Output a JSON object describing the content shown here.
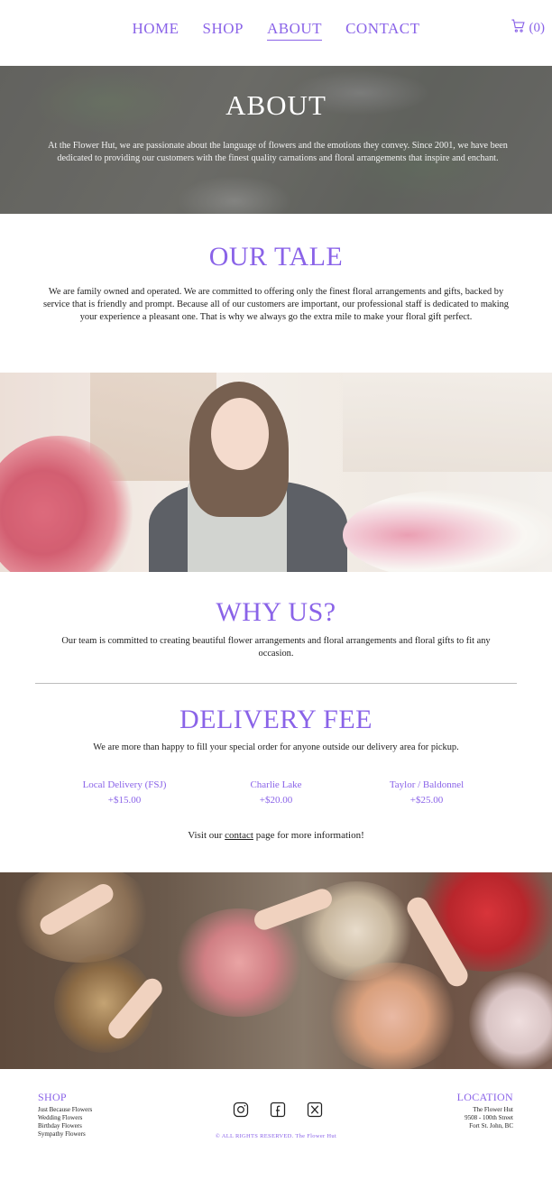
{
  "nav": {
    "links": [
      "HOME",
      "SHOP",
      "ABOUT",
      "CONTACT"
    ],
    "active": "ABOUT",
    "cart_count": "(0)",
    "cart_icon": "cart-icon"
  },
  "hero": {
    "title": "ABOUT",
    "text": "At the Flower Hut, we are passionate about the language of flowers and the emotions they convey. Since 2001, we have been dedicated to providing our customers with the finest quality carnations and floral arrangements that inspire and enchant."
  },
  "tale": {
    "title": "OUR TALE",
    "text": "We are family owned and operated. We are committed to offering only the finest floral arrangements and gifts, backed by service that is friendly and prompt. Because all of our customers are important, our professional staff is dedicated to making your experience a pleasant one. That is why we always go the extra mile to make your floral gift perfect."
  },
  "why": {
    "title": "WHY US?",
    "text": "Our team is committed to creating beautiful flower arrangements and floral arrangements and floral gifts to fit any occasion."
  },
  "delivery": {
    "title": "DELIVERY FEE",
    "text": "We are more than happy to fill your special order for anyone outside our delivery area for pickup.",
    "fees": [
      {
        "area": "Local Delivery (FSJ)",
        "price": "+$15.00"
      },
      {
        "area": "Charlie Lake",
        "price": "+$20.00"
      },
      {
        "area": "Taylor / Baldonnel",
        "price": "+$25.00"
      }
    ],
    "visit_before": "Visit our ",
    "visit_link": "contact",
    "visit_after": " page for more information!"
  },
  "footer": {
    "shop_title": "SHOP",
    "shop_items": [
      "Just Because Flowers",
      "Wedding Flowers",
      "Birthday Flowers",
      "Sympathy Flowers"
    ],
    "location_title": "LOCATION",
    "location_lines": [
      "The Flower Hut",
      "9508 - 100th Street",
      "Fort St. John, BC"
    ],
    "socials": [
      "instagram-icon",
      "facebook-icon",
      "x-icon"
    ],
    "copyright": "© ALL RIGHTS RESERVED. The Flower Hut"
  },
  "colors": {
    "accent": "#8a63e8"
  }
}
